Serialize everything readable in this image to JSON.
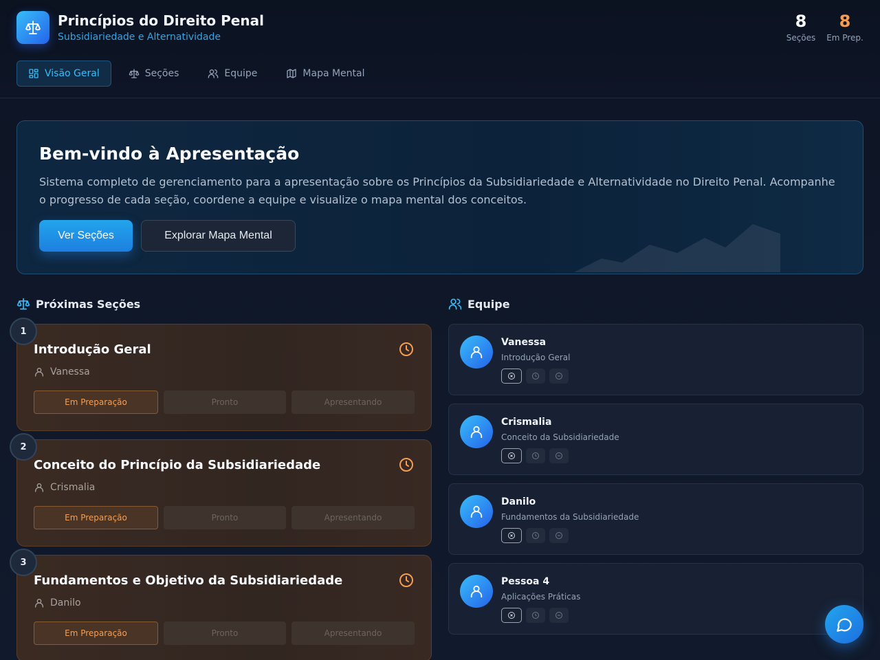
{
  "app": {
    "title": "Princípios do Direito Penal",
    "subtitle": "Subsidiariedade e Alternatividade",
    "logo_icon": "scale-icon"
  },
  "stats": [
    {
      "value": "8",
      "label": "Seções"
    },
    {
      "value": "8",
      "label": "Em Prep."
    }
  ],
  "nav": {
    "tabs": [
      {
        "label": "Visão Geral",
        "icon": "grid-icon",
        "active": true
      },
      {
        "label": "Seções",
        "icon": "scale-icon",
        "active": false
      },
      {
        "label": "Equipe",
        "icon": "users-icon",
        "active": false
      },
      {
        "label": "Mapa Mental",
        "icon": "map-icon",
        "active": false
      }
    ]
  },
  "hero": {
    "title": "Bem-vindo à Apresentação",
    "description": "Sistema completo de gerenciamento para a apresentação sobre os Princípios da Subsidiariedade e Alternatividade no Direito Penal. Acompanhe o progresso de cada seção, coordene a equipe e visualize o mapa mental dos conceitos.",
    "primary_button": "Ver Seções",
    "secondary_button": "Explorar Mapa Mental"
  },
  "upcoming": {
    "heading": "Próximas Seções",
    "sections": [
      {
        "number": "1",
        "title": "Introdução Geral",
        "owner": "Vanessa",
        "statuses": [
          "Em Preparação",
          "Pronto",
          "Apresentando"
        ]
      },
      {
        "number": "2",
        "title": "Conceito do Princípio da Subsidiariedade",
        "owner": "Crismalia",
        "statuses": [
          "Em Preparação",
          "Pronto",
          "Apresentando"
        ]
      },
      {
        "number": "3",
        "title": "Fundamentos e Objetivo da Subsidiariedade",
        "owner": "Danilo",
        "statuses": [
          "Em Preparação",
          "Pronto",
          "Apresentando"
        ]
      }
    ]
  },
  "team": {
    "heading": "Equipe",
    "members": [
      {
        "name": "Vanessa",
        "role": "Introdução Geral"
      },
      {
        "name": "Crismalia",
        "role": "Conceito da Subsidiariedade"
      },
      {
        "name": "Danilo",
        "role": "Fundamentos da Subsidiariedade"
      },
      {
        "name": "Pessoa 4",
        "role": "Aplicações Práticas"
      }
    ]
  },
  "colors": {
    "accent": "#38bdf8",
    "primary": "#1d7fe0",
    "warning": "#f59e52",
    "background": "#0f1728"
  },
  "fab": {
    "icon": "chat-icon"
  }
}
